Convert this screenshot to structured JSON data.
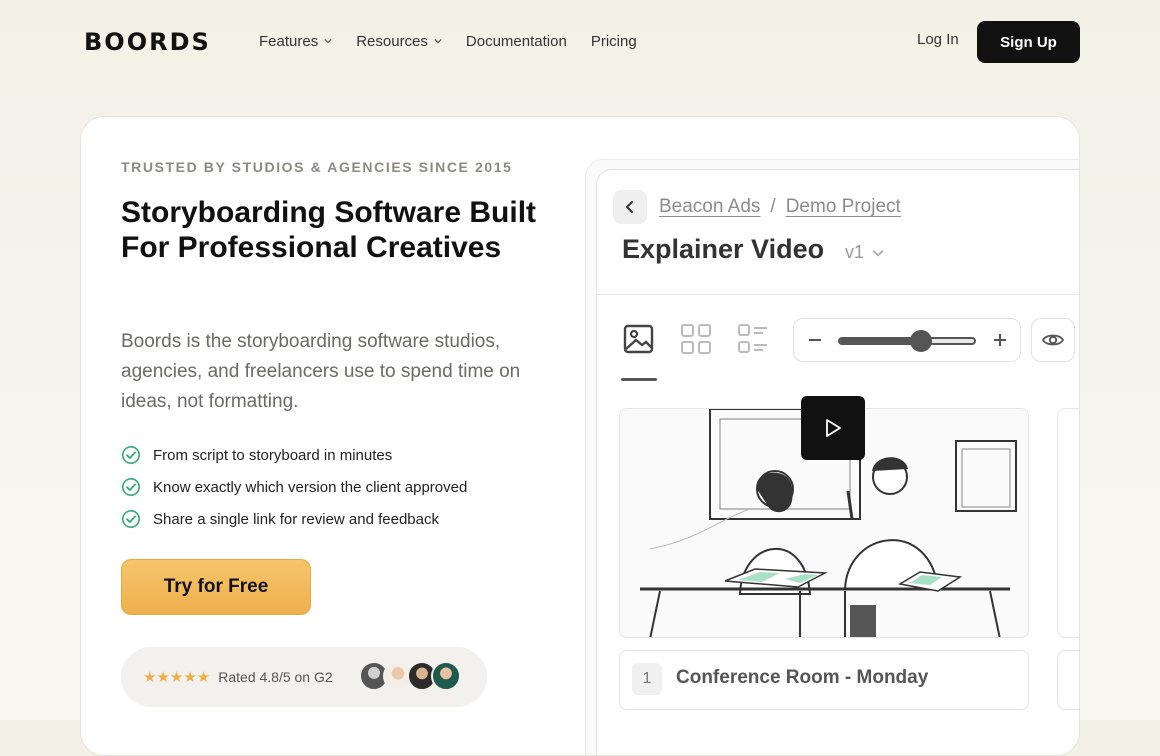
{
  "nav": {
    "logo": "BOORDS",
    "links": [
      {
        "label": "Features",
        "has_dropdown": true
      },
      {
        "label": "Resources",
        "has_dropdown": true
      },
      {
        "label": "Documentation",
        "has_dropdown": false
      },
      {
        "label": "Pricing",
        "has_dropdown": false
      }
    ],
    "login": "Log In",
    "signup": "Sign Up"
  },
  "hero": {
    "eyebrow": "TRUSTED BY STUDIOS & AGENCIES SINCE 2015",
    "title": "Storyboarding Software Built For Professional Creatives",
    "lede": "Boords is the storyboarding software studios, agencies, and freelancers use to spend time on ideas, not formatting.",
    "benefits": [
      "From script to storyboard in minutes",
      "Know exactly which version the client approved",
      "Share a single link for review and feedback"
    ],
    "cta": "Try for Free",
    "rating": {
      "stars": "★★★★★",
      "text": "Rated 4.8/5 on G2",
      "value": 4.8
    }
  },
  "app": {
    "breadcrumb": [
      "Beacon Ads",
      "Demo Project"
    ],
    "breadcrumb_sep": "/",
    "title": "Explainer Video",
    "version": "v1",
    "zoom_level": 0.6,
    "scene": {
      "number": "1",
      "title": "Conference Room - Monday"
    }
  },
  "colors": {
    "accent": "#f0ae48",
    "dark": "#111111",
    "check": "#3aa87a"
  }
}
